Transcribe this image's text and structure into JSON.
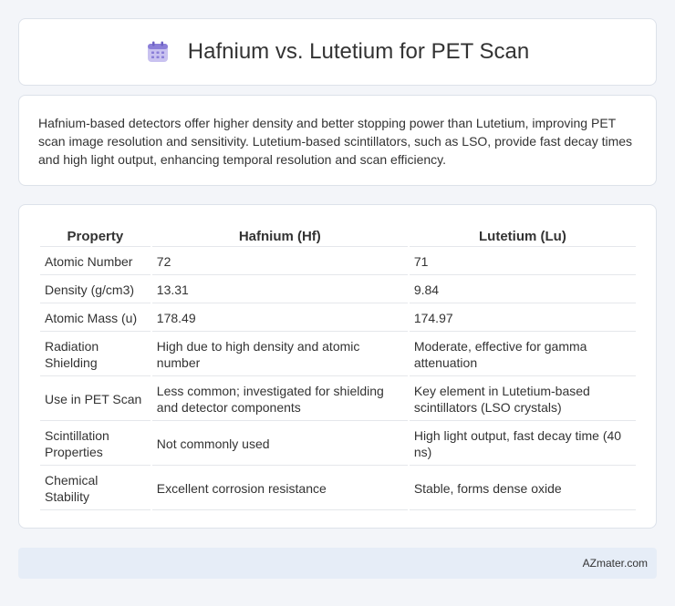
{
  "header": {
    "title": "Hafnium vs. Lutetium for PET Scan",
    "icon": "calendar-grid-icon"
  },
  "description": "Hafnium-based detectors offer higher density and better stopping power than Lutetium, improving PET scan image resolution and sensitivity. Lutetium-based scintillators, such as LSO, provide fast decay times and high light output, enhancing temporal resolution and scan efficiency.",
  "table": {
    "headers": [
      "Property",
      "Hafnium (Hf)",
      "Lutetium (Lu)"
    ],
    "rows": [
      [
        "Atomic Number",
        "72",
        "71"
      ],
      [
        "Density (g/cm3)",
        "13.31",
        "9.84"
      ],
      [
        "Atomic Mass (u)",
        "178.49",
        "174.97"
      ],
      [
        "Radiation Shielding",
        "High due to high density and atomic number",
        "Moderate, effective for gamma attenuation"
      ],
      [
        "Use in PET Scan",
        "Less common; investigated for shielding and detector components",
        "Key element in Lutetium-based scintillators (LSO crystals)"
      ],
      [
        "Scintillation Properties",
        "Not commonly used",
        "High light output, fast decay time (40 ns)"
      ],
      [
        "Chemical Stability",
        "Excellent corrosion resistance",
        "Stable, forms dense oxide"
      ]
    ]
  },
  "footer": {
    "credit": "AZmater.com"
  },
  "colors": {
    "accent": "#8b7fd8",
    "footer_bg": "#e6edf7",
    "page_bg": "#f3f5f9"
  }
}
